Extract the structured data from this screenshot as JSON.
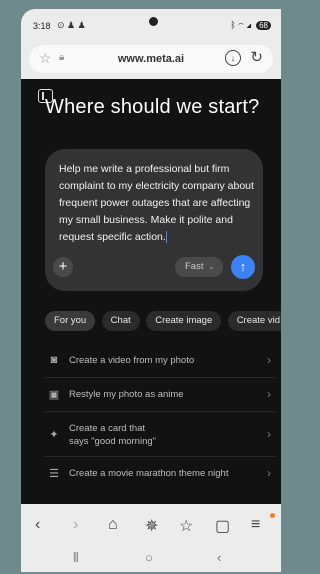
{
  "status_bar": {
    "time": "3:18",
    "battery": "68"
  },
  "browser": {
    "url": "www.meta.ai"
  },
  "heading": "Where should we start?",
  "prompt": {
    "text": "Help me write a professional but firm complaint to my electricity company about frequent power outages that are affecting my small business. Make it polite and request specific action.",
    "model_label": "Fast"
  },
  "chips": [
    "For you",
    "Chat",
    "Create image",
    "Create vid"
  ],
  "suggestions": [
    {
      "icon": "camera-icon",
      "line1": "Create a video from my photo",
      "line2": ""
    },
    {
      "icon": "image-icon",
      "line1": "Restyle my photo as anime",
      "line2": ""
    },
    {
      "icon": "sparkle-icon",
      "line1": "Create a card that",
      "line2": "says \"good morning\""
    },
    {
      "icon": "list-icon",
      "line1": "Create a movie marathon theme night",
      "line2": ""
    }
  ],
  "colors": {
    "accent": "#3b82f6",
    "background": "#121212",
    "card": "#333333"
  }
}
